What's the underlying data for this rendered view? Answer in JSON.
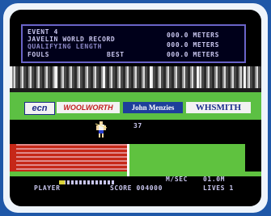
{
  "scoreboard": {
    "event_line": "EVENT 4",
    "title_line": "JAVELIN WORLD RECORD",
    "qualifying_line": "QUALIFYING LENGTH",
    "fouls_label": "FOULS",
    "best_label": "BEST",
    "right_values": [
      "000.0 METERS",
      "000.0 METERS",
      "000.0 METERS"
    ]
  },
  "ads": {
    "ad1": "ecn",
    "ad2": "WOOLWORTH",
    "ad3": "John Menzies",
    "ad4": "WHSMITH"
  },
  "field": {
    "distance_readout": "37"
  },
  "hud": {
    "player_label": "PLAYER",
    "speed_unit": "M/SEC",
    "speed_value": "01.0M",
    "score_label": "SCORE 004000",
    "lives_label": "LIVES 1",
    "speed_fraction": 0.1
  },
  "colors": {
    "runway": "#c62818",
    "grass": "#5fc23f",
    "scoreboard_text": "#c9c6ee",
    "frame": "#1f58a8"
  }
}
